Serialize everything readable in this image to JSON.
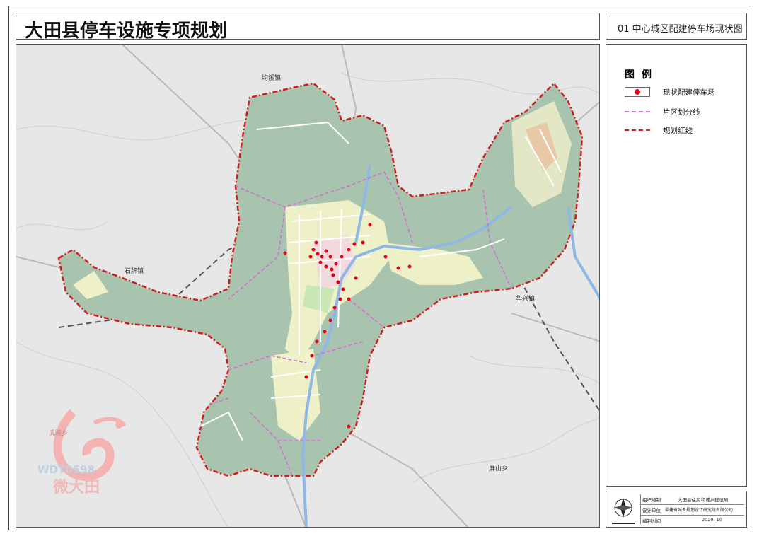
{
  "title": "大田县停车设施专项规划",
  "sheet_title": "01 中心城区配建停车场现状图",
  "legend": {
    "title": "图例",
    "items": [
      {
        "label": "现状配建停车场",
        "icon": "red-dot-icon",
        "color": "#e60012"
      },
      {
        "label": "片区划分线",
        "icon": "magenta-dashed-line-icon",
        "color": "#d46ad4"
      },
      {
        "label": "规划红线",
        "icon": "red-dash-dot-line-icon",
        "color": "#d01c1c"
      }
    ]
  },
  "map_labels": {
    "junxi": "均溪镇",
    "shipai": "石牌镇",
    "huaxing": "华兴镇",
    "pingshan": "屏山乡"
  },
  "watermark": {
    "wulin": "武陵乡",
    "code": "WDT0598",
    "name": "微大田"
  },
  "info_block": {
    "unit_label": "组织编制",
    "unit_value": "大田县住房和城乡建设局",
    "design_label": "设计单位",
    "design_value": "福建省城乡规划设计研究院有限公司",
    "date_label": "编制时间",
    "date_value": "2020. 10"
  },
  "colors": {
    "map_background": "#e8e8e8",
    "planning_area": "#a9c4ae",
    "red_line": "#d01c1c",
    "district_line": "#d46ad4",
    "river": "#9fc3ea",
    "parking_dot": "#e60012"
  }
}
